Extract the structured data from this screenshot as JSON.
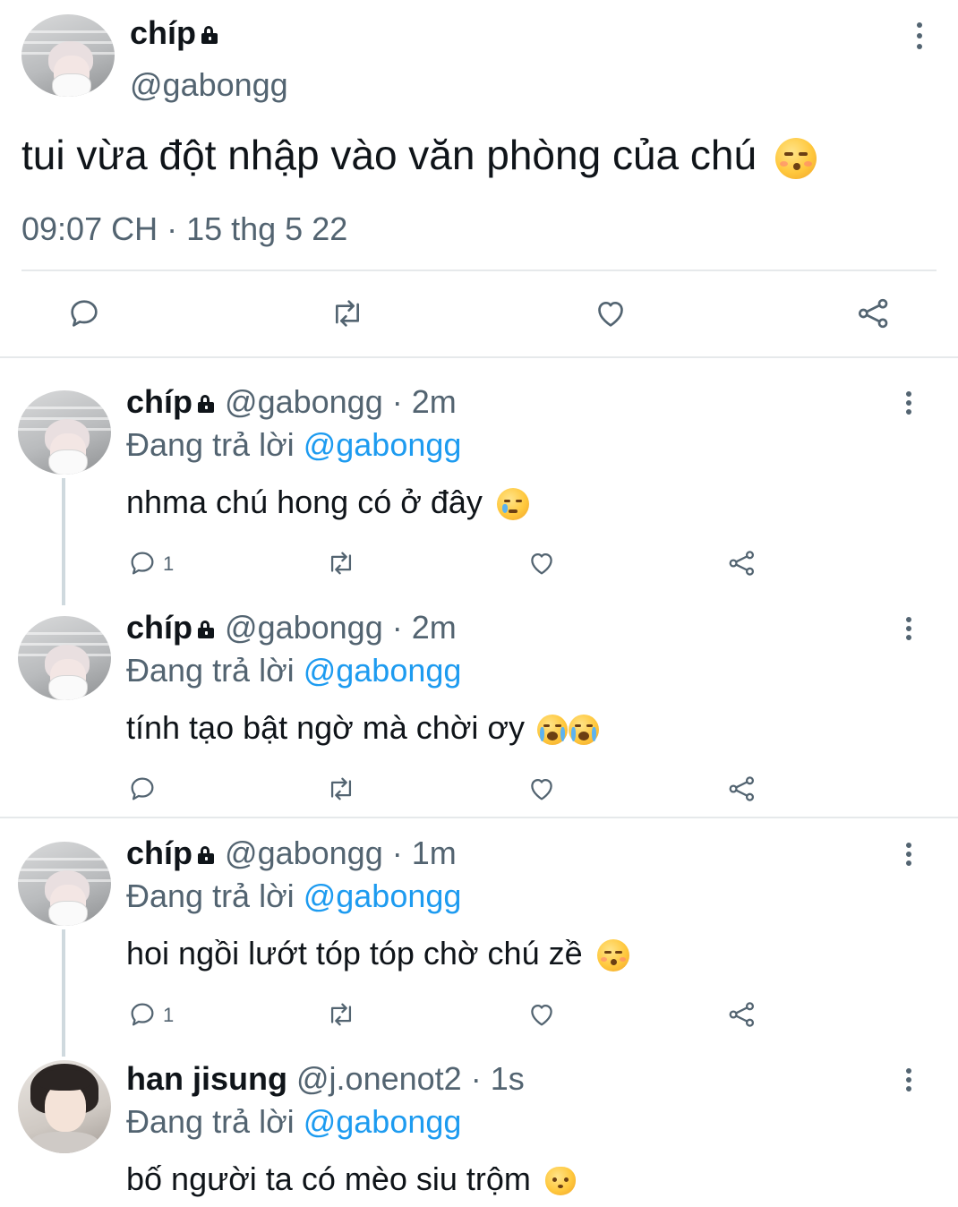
{
  "main_tweet": {
    "author_name": "chíp",
    "author_handle": "@gabongg",
    "text": "tui vừa đột nhập vào văn phòng của chú",
    "timestamp": "09:07 CH · 15 thg 5 22"
  },
  "replies": [
    {
      "author_name": "chíp",
      "author_handle": "@gabongg",
      "time": "· 2m",
      "replying_prefix": "Đang trả lời",
      "replying_to": "@gabongg",
      "text": "nhma chú hong có ở đây",
      "reply_count": "1"
    },
    {
      "author_name": "chíp",
      "author_handle": "@gabongg",
      "time": "· 2m",
      "replying_prefix": "Đang trả lời",
      "replying_to": "@gabongg",
      "text": "tính tạo bật ngờ mà chời ơy",
      "reply_count": ""
    },
    {
      "author_name": "chíp",
      "author_handle": "@gabongg",
      "time": "· 1m",
      "replying_prefix": "Đang trả lời",
      "replying_to": "@gabongg",
      "text": "hoi ngồi lướt tóp tóp chờ chú zề",
      "reply_count": "1"
    },
    {
      "author_name": "han jisung",
      "author_handle": "@j.onenot2",
      "time": "· 1s",
      "replying_prefix": "Đang trả lời",
      "replying_to": "@gabongg",
      "text": "bố người ta có mèo siu trộm",
      "reply_count": ""
    }
  ],
  "icons": {
    "reply": "comment-icon",
    "retweet": "retweet-icon",
    "like": "heart-icon",
    "share": "share-icon",
    "more": "more-vertical-icon",
    "protected": "lock-icon"
  },
  "colors": {
    "text": "#0f1419",
    "secondary": "#536471",
    "link": "#1d9bf0",
    "divider": "#e6e9eb"
  }
}
